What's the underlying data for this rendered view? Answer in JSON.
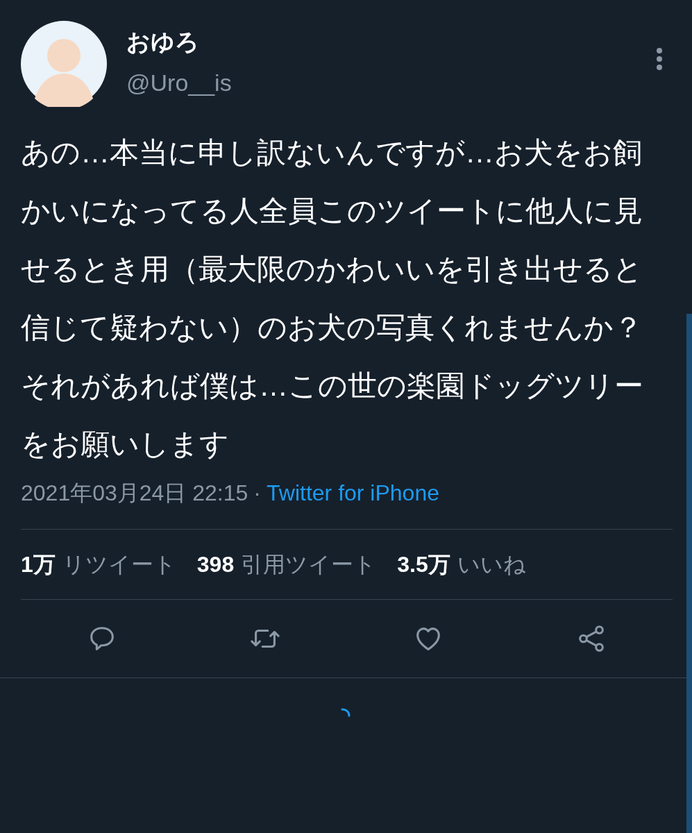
{
  "author": {
    "name": "おゆろ",
    "handle": "@Uro__is"
  },
  "tweet": {
    "text": "あの…本当に申し訳ないんですが…お犬をお飼かいになってる人全員このツイートに他人に見せるとき用（最大限のかわいいを引き出せると信じて疑わない）のお犬の写真くれませんか？それがあれば僕は…この世の楽園ドッグツリーをお願いします",
    "timestamp": "2021年03月24日 22:15",
    "separator": "·",
    "source": "Twitter for iPhone"
  },
  "stats": [
    {
      "count": "1万",
      "label": "リツイート"
    },
    {
      "count": "398",
      "label": "引用ツイート"
    },
    {
      "count": "3.5万",
      "label": "いいね"
    }
  ],
  "actions": [
    {
      "kind": "reply"
    },
    {
      "kind": "retweet"
    },
    {
      "kind": "like"
    },
    {
      "kind": "share"
    }
  ]
}
